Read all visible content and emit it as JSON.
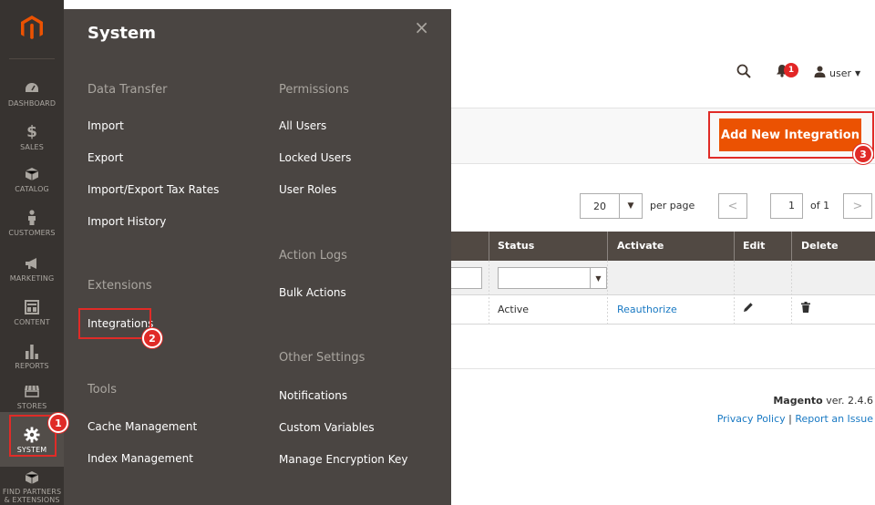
{
  "sidebar": {
    "items": [
      {
        "label": "DASHBOARD",
        "icon": "dashboard-icon"
      },
      {
        "label": "SALES",
        "icon": "dollar-icon"
      },
      {
        "label": "CATALOG",
        "icon": "cube-icon"
      },
      {
        "label": "CUSTOMERS",
        "icon": "person-icon"
      },
      {
        "label": "MARKETING",
        "icon": "megaphone-icon"
      },
      {
        "label": "CONTENT",
        "icon": "layout-icon"
      },
      {
        "label": "REPORTS",
        "icon": "bar-chart-icon"
      },
      {
        "label": "STORES",
        "icon": "storefront-icon"
      },
      {
        "label": "SYSTEM",
        "icon": "gear-icon"
      },
      {
        "label": "FIND PARTNERS",
        "label2": "& EXTENSIONS",
        "icon": "puzzle-cube-icon"
      }
    ]
  },
  "flyout": {
    "title": "System",
    "close": "×",
    "left": {
      "data_transfer": {
        "heading": "Data Transfer",
        "links": [
          "Import",
          "Export",
          "Import/Export Tax Rates",
          "Import History"
        ]
      },
      "extensions": {
        "heading": "Extensions",
        "links": [
          "Integrations"
        ]
      },
      "tools": {
        "heading": "Tools",
        "links": [
          "Cache Management",
          "Index Management"
        ]
      }
    },
    "right": {
      "permissions": {
        "heading": "Permissions",
        "links": [
          "All Users",
          "Locked Users",
          "User Roles"
        ]
      },
      "action_logs": {
        "heading": "Action Logs",
        "links": [
          "Bulk Actions"
        ]
      },
      "other_settings": {
        "heading": "Other Settings",
        "links": [
          "Notifications",
          "Custom Variables",
          "Manage Encryption Key"
        ]
      }
    }
  },
  "header": {
    "notification_count": "1",
    "user_label": "user"
  },
  "actions": {
    "add_new": "Add New Integration"
  },
  "pager": {
    "per_page_value": "20",
    "per_page_label": "per page",
    "current_page": "1",
    "of_label": "of 1",
    "prev": "<",
    "next": ">"
  },
  "grid": {
    "columns": [
      "Status",
      "Activate",
      "Edit",
      "Delete"
    ],
    "row": {
      "status": "Active",
      "activate": "Reauthorize"
    }
  },
  "footer": {
    "brand": "Magento",
    "version": " ver. 2.4.6",
    "privacy": "Privacy Policy",
    "separator": " | ",
    "report": "Report an Issue"
  },
  "annotations": {
    "step1": "1",
    "step2": "2",
    "step3": "3"
  },
  "colors": {
    "sidebar": "#373330",
    "flyout": "#4a4542",
    "primary": "#eb5202",
    "grid_header": "#514943",
    "link": "#1979c3",
    "highlight": "#e02b27"
  }
}
